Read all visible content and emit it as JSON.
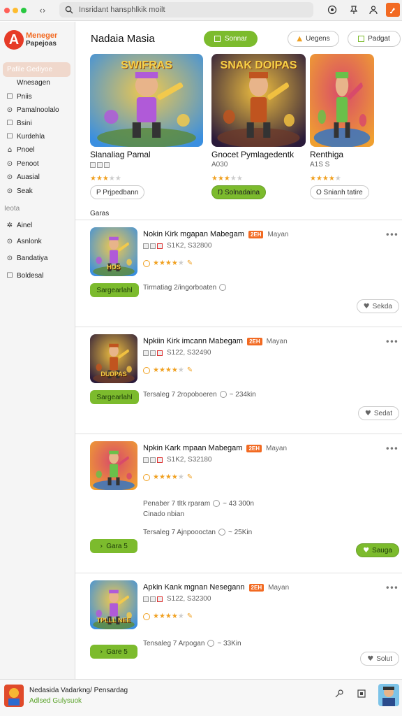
{
  "window": {
    "dot_colors": [
      "#ff5f57",
      "#febc2e",
      "#28c840"
    ],
    "nav_glyph": "‹›",
    "search_text": "Insridant hansphlkik moilt"
  },
  "toolbar": {
    "icons": [
      "target-icon",
      "pin-icon",
      "user-icon",
      "app-menu-icon"
    ]
  },
  "sidebar": {
    "logo_letter": "A",
    "logo_line1": "Meneger",
    "logo_line2": "Papejoas",
    "active_item": "Pafile Gediyoe",
    "items": [
      {
        "label": "Wnesagen",
        "icon": ""
      },
      {
        "label": "Pniis",
        "icon": "☐"
      },
      {
        "label": "Pamalnoolalo",
        "icon": "⊙"
      },
      {
        "label": "Bsini",
        "icon": "☐"
      },
      {
        "label": "Kurdehla",
        "icon": "☐"
      },
      {
        "label": "Pnoel",
        "icon": "⌂"
      },
      {
        "label": "Penoot",
        "icon": "⊙"
      },
      {
        "label": "Auasial",
        "icon": "⊙"
      },
      {
        "label": "Seak",
        "icon": "⊙"
      }
    ],
    "section_label": "Ieota",
    "items2": [
      {
        "label": "Ainel",
        "icon": "✲"
      },
      {
        "label": "Asnlonk",
        "icon": "⊙"
      },
      {
        "label": "Bandatiya",
        "icon": "⊙"
      },
      {
        "label": "Boldesal",
        "icon": "☐"
      }
    ]
  },
  "header": {
    "title": "Nadaia Masia",
    "primary_button": "Sonnar",
    "btn_upgrade": "Uegens",
    "btn_padget": "Padgat"
  },
  "featured": [
    {
      "title": "Slanaliag Pamal",
      "subtitle": "",
      "rating": 3,
      "button": "P Prjpedbann",
      "art_text": "SWIFRAS",
      "accent": "#2a73c9",
      "btn_style": "outline"
    },
    {
      "title": "Gnocet Pymlagedentk",
      "subtitle": "A030",
      "rating": 3,
      "button": "Ŋ Solnadaina",
      "art_text": "SNAK DOIPAS",
      "accent": "#c0541f",
      "btn_style": "green"
    },
    {
      "title": "Renthiga",
      "subtitle": "A1S S",
      "rating": 4,
      "button": "O Snianh tatire",
      "art_text": "",
      "accent": "#e8a21b",
      "btn_style": "outline"
    }
  ],
  "list_section_label": "Garas",
  "list": [
    {
      "title": "Nokin Kirk mgapan Mabegam",
      "badge": "2EH",
      "tag": "Mayan",
      "meta": "S1K2, S32800",
      "rating": 4,
      "primary": "Sargearlahl",
      "line1": "Tirmatiag 2/ingorboaten",
      "line2": "",
      "line3": "",
      "secondary": "Sekda",
      "secondary_style": "outline",
      "art_text": "HOS"
    },
    {
      "title": "Npkiin Kirk imcann Mabegam",
      "badge": "2EH",
      "tag": "Mayan",
      "meta": "S122, S32490",
      "rating": 4,
      "primary": "Sargearlahl",
      "line1": "Tersaleg 7 2ropoboeren",
      "line2": "~ 234kin",
      "line3": "",
      "secondary": "Sedat",
      "secondary_style": "outline",
      "art_text": "DUDPAS"
    },
    {
      "title": "Npkin Kark mpaan Mabegam",
      "badge": "2EH",
      "tag": "Mayan",
      "meta": "S1K2, S32180",
      "rating": 4,
      "primary": "Gara 5",
      "line1": "Penaber 7 tltk rparam",
      "line2": "~ 43 300n",
      "line3": "Cinado nbian",
      "line4": "Tersaleg 7 Ajnpoooctan",
      "line4b": "~ 25Kin",
      "secondary": "Sauga",
      "secondary_style": "green",
      "art_text": ""
    },
    {
      "title": "Apkin Kank mgnan Nesegann",
      "badge": "2EH",
      "tag": "Mayan",
      "meta": "S122, S32300",
      "rating": 4,
      "primary": "Gare 5",
      "line1": "Tensaleg 7 Arpogan",
      "line2": "~ 33Kin",
      "line3": "",
      "secondary": "Solut",
      "secondary_style": "outline",
      "art_text": "TPLLL NEE"
    }
  ],
  "bottom": {
    "line1": "Nedasida Vadarkng/ Pensardag",
    "line2": "Adlsed Gulysuok",
    "icons": [
      "key-icon",
      "square-icon"
    ]
  }
}
